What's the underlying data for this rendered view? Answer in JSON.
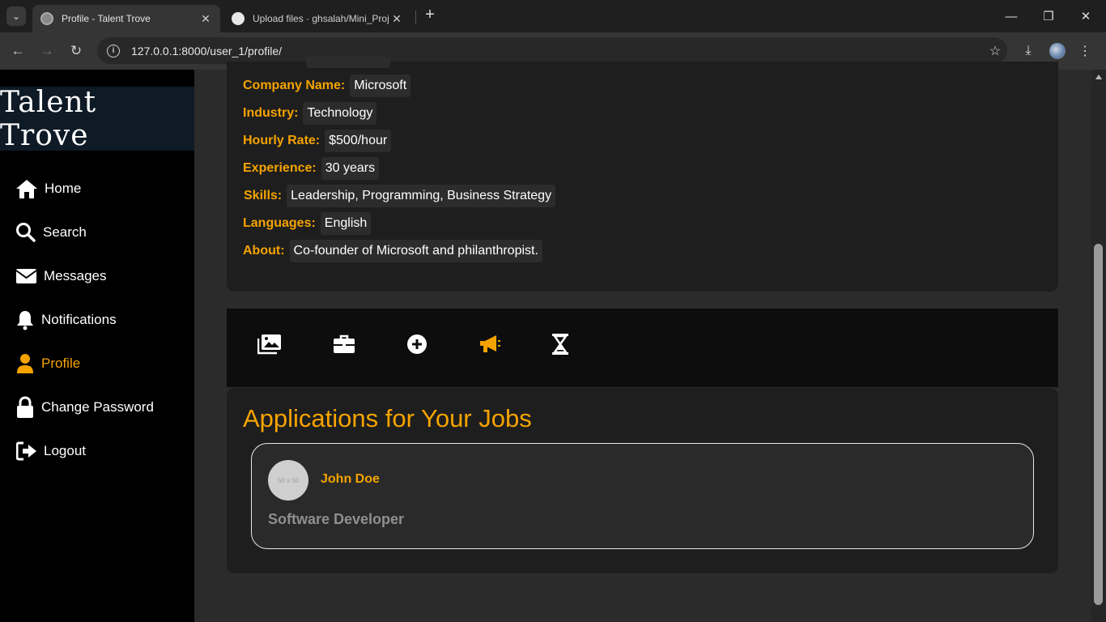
{
  "browser": {
    "tabs": [
      {
        "title": "Profile - Talent Trove",
        "active": true
      },
      {
        "title": "Upload files · ghsalah/Mini_Proj",
        "active": false
      }
    ],
    "url": "127.0.0.1:8000/user_1/profile/"
  },
  "sidebar": {
    "brand": "Talent Trove",
    "items": [
      {
        "label": "Home",
        "icon": "home-icon"
      },
      {
        "label": "Search",
        "icon": "search-icon"
      },
      {
        "label": "Messages",
        "icon": "envelope-icon"
      },
      {
        "label": "Notifications",
        "icon": "bell-icon"
      },
      {
        "label": "Profile",
        "icon": "user-icon",
        "active": true
      },
      {
        "label": "Change Password",
        "icon": "lock-icon"
      },
      {
        "label": "Logout",
        "icon": "logout-icon"
      }
    ]
  },
  "profile": {
    "fields": [
      {
        "label": "Company Name:",
        "value": "Microsoft"
      },
      {
        "label": "Industry:",
        "value": "Technology"
      },
      {
        "label": "Hourly Rate:",
        "value": "$500/hour"
      },
      {
        "label": "Experience:",
        "value": "30 years"
      },
      {
        "label": "Skills:",
        "value": "Leadership, Programming, Business Strategy"
      },
      {
        "label": "Languages:",
        "value": "English"
      },
      {
        "label": "About:",
        "value": "Co-founder of Microsoft and philanthropist."
      }
    ]
  },
  "iconbar": [
    "gallery-icon",
    "briefcase-icon",
    "add-circle-icon",
    "megaphone-icon",
    "hourglass-icon"
  ],
  "applications": {
    "title": "Applications for Your Jobs",
    "items": [
      {
        "avatar_text": "50 x 50",
        "name": "John Doe",
        "role": "Software Developer"
      }
    ]
  },
  "colors": {
    "accent": "#f5a300",
    "sidebar_bg": "#000000",
    "card_bg": "#1e1e1e"
  }
}
